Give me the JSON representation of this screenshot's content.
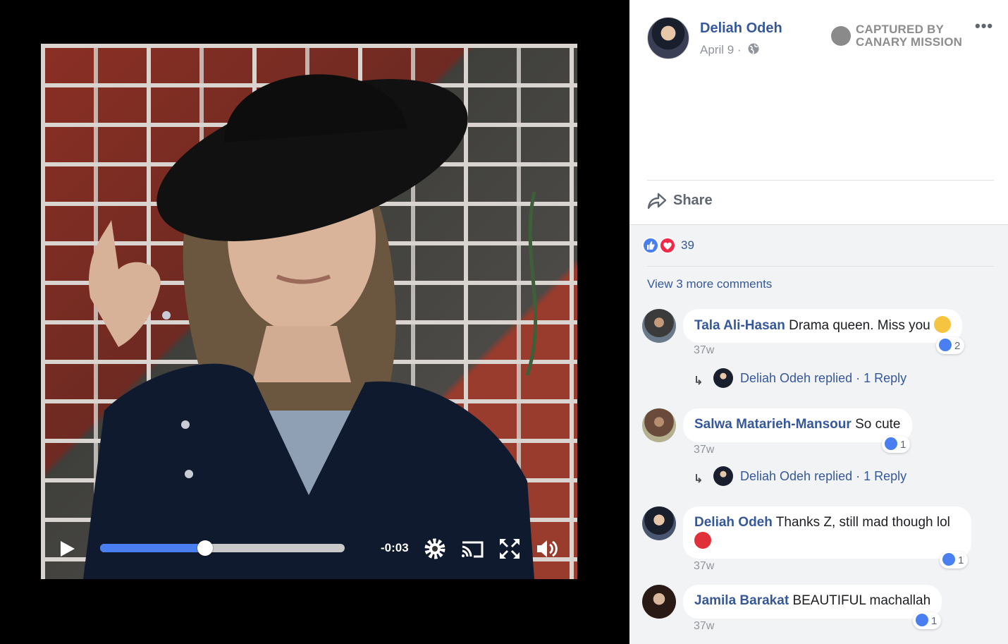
{
  "video": {
    "time_remaining": "-0:03",
    "progress_fraction": 0.43
  },
  "post": {
    "author": "Deliah Odeh",
    "date": "April 9 ·",
    "watermark": {
      "line1": "CAPTURED BY",
      "line2": "CANARY MISSION"
    },
    "more_label": "•••",
    "share_label": "Share"
  },
  "reactions": {
    "count": "39",
    "types": [
      "like",
      "love"
    ]
  },
  "view_more": "View 3 more comments",
  "comments": [
    {
      "name": "Tala Ali-Hasan",
      "text": "Drama queen. Miss you",
      "emoji": "kissing-face",
      "likes": "2",
      "time": "37w",
      "reply": "Deliah Odeh replied · 1 Reply"
    },
    {
      "name": "Salwa Matarieh-Mansour",
      "text": "So cute",
      "likes": "1",
      "time": "37w",
      "reply": "Deliah Odeh replied · 1 Reply"
    },
    {
      "name": "Deliah Odeh",
      "text": "Thanks Z, still mad though lol",
      "emoji": "devil-face",
      "likes": "1",
      "time": "37w"
    },
    {
      "name": "Jamila Barakat",
      "text": "BEAUTIFUL machallah",
      "likes": "1",
      "time": "37w"
    }
  ],
  "colors": {
    "link": "#365899",
    "accent": "#4a7ff2",
    "love": "#f0284a",
    "panel_bg": "#f2f3f5"
  }
}
